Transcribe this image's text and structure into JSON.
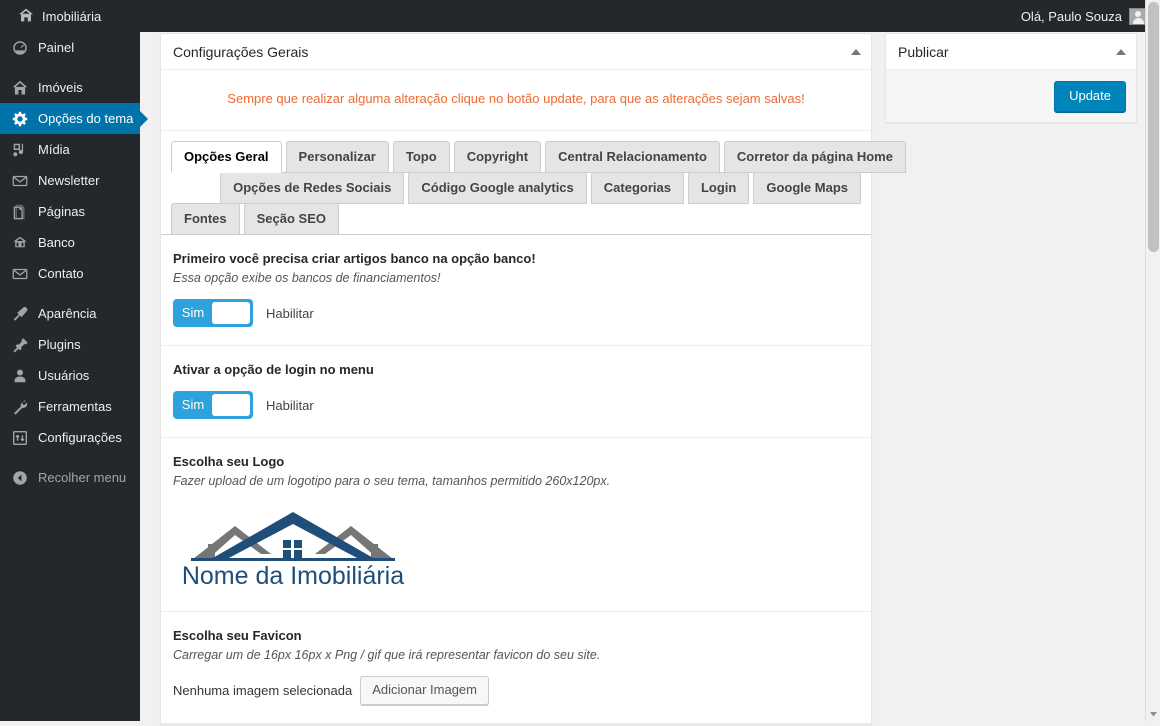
{
  "adminbar": {
    "site_name": "Imobiliária",
    "site_icon": "home-icon",
    "greeting": "Olá, Paulo Souza",
    "avatar_icon": "avatar-icon"
  },
  "sidebar": {
    "items": [
      {
        "label": "Painel",
        "icon": "dashboard-icon",
        "active": false
      },
      {
        "label": "Imóveis",
        "icon": "home-icon",
        "active": false
      },
      {
        "label": "Opções do tema",
        "icon": "gear-icon",
        "active": true
      },
      {
        "label": "Mídia",
        "icon": "media-icon",
        "active": false
      },
      {
        "label": "Newsletter",
        "icon": "envelope-icon",
        "active": false
      },
      {
        "label": "Páginas",
        "icon": "pages-icon",
        "active": false
      },
      {
        "label": "Banco",
        "icon": "bank-icon",
        "active": false
      },
      {
        "label": "Contato",
        "icon": "envelope-icon",
        "active": false
      },
      {
        "label": "Aparência",
        "icon": "paintbrush-icon",
        "active": false
      },
      {
        "label": "Plugins",
        "icon": "plug-icon",
        "active": false
      },
      {
        "label": "Usuários",
        "icon": "user-icon",
        "active": false
      },
      {
        "label": "Ferramentas",
        "icon": "wrench-icon",
        "active": false
      },
      {
        "label": "Configurações",
        "icon": "settings-icon",
        "active": false
      }
    ],
    "collapse": {
      "label": "Recolher menu",
      "icon": "collapse-icon"
    }
  },
  "main": {
    "panel_title": "Configurações Gerais",
    "notice": "Sempre que realizar alguma alteração clique no botão update, para que as alterações sejam salvas!",
    "tab_rows": [
      [
        {
          "label": "Opções Geral",
          "selected": true
        },
        {
          "label": "Personalizar",
          "selected": false
        },
        {
          "label": "Topo",
          "selected": false
        },
        {
          "label": "Copyright",
          "selected": false
        },
        {
          "label": "Central Relacionamento",
          "selected": false
        },
        {
          "label": "Corretor da página Home",
          "selected": false
        }
      ],
      [
        {
          "label": "Opções de Redes Sociais",
          "selected": false
        },
        {
          "label": "Código Google analytics",
          "selected": false
        },
        {
          "label": "Categorias",
          "selected": false
        },
        {
          "label": "Login",
          "selected": false
        },
        {
          "label": "Google Maps",
          "selected": false
        }
      ],
      [
        {
          "label": "Fontes",
          "selected": false
        },
        {
          "label": "Seção SEO",
          "selected": false
        }
      ]
    ],
    "sections": [
      {
        "title": "Primeiro você precisa criar artigos banco na opção banco!",
        "desc": "Essa opção exibe os bancos de financiamentos!",
        "switch_value": "Sim",
        "switch_label": "Habilitar"
      },
      {
        "title": "Ativar a opção de login no menu",
        "desc": "",
        "switch_value": "Sim",
        "switch_label": "Habilitar"
      }
    ],
    "logo_section": {
      "title": "Escolha seu Logo",
      "desc": "Fazer upload de um logotipo para o seu tema, tamanhos permitido 260x120px.",
      "logo_text": "Nome da Imobiliária"
    },
    "favicon_section": {
      "title": "Escolha seu Favicon",
      "desc": "Carregar um de 16px 16px x Png / gif que irá representar favicon do seu site.",
      "empty_text": "Nenhuma imagem selecionada",
      "button_label": "Adicionar Imagem"
    }
  },
  "sidebox": {
    "publish_title": "Publicar",
    "update_label": "Update"
  },
  "colors": {
    "admin_dark": "#23282d",
    "accent_blue": "#0073aa",
    "switch_blue": "#2ea2dd",
    "notice_orange": "#ee6a33",
    "button_blue": "#0085ba",
    "logo_blue": "#1f4e79",
    "logo_gray": "#767676"
  }
}
